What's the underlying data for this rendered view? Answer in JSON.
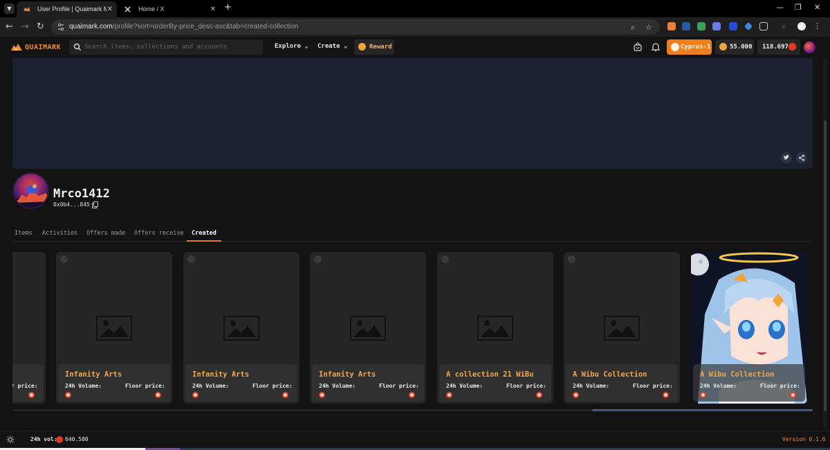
{
  "browser": {
    "tabs": [
      {
        "title": "User Profile | Quaimark Marketplace",
        "active": true
      },
      {
        "title": "Home / X",
        "active": false
      }
    ],
    "url_host": "quaimark.com",
    "url_path": "/profile?sort=orderBy-price_desc-asc&tab=created-collection"
  },
  "header": {
    "logo_text": "QUAIMARK",
    "search_placeholder": "Search items, collections and accounts",
    "explore_label": "Explore",
    "create_label": "Create",
    "reward_label": "Reward",
    "chain_label": "Cyprus-1",
    "points_value": "55.000",
    "balance_value": "118.697"
  },
  "profile": {
    "name": "Mrco1412",
    "address": "0x0b4...845"
  },
  "tabs": [
    "Items",
    "Activities",
    "Offers made",
    "Offers receive",
    "Created"
  ],
  "active_tab": "Created",
  "cards": [
    {
      "title": "",
      "vol_label": "",
      "floor_label": "r price:",
      "partial": true
    },
    {
      "title": "Infanity Arts",
      "vol_label": "24h Volume:",
      "floor_label": "Floor price:"
    },
    {
      "title": "Infanity Arts",
      "vol_label": "24h Volume:",
      "floor_label": "Floor price:"
    },
    {
      "title": "Infanity Arts",
      "vol_label": "24h Volume:",
      "floor_label": "Floor price:"
    },
    {
      "title": "A collection 21 WiBu",
      "vol_label": "24h Volume:",
      "floor_label": "Floor price:"
    },
    {
      "title": "A Wibu Collection",
      "vol_label": "24h Volume:",
      "floor_label": "Floor price:"
    },
    {
      "title": "A Wibu Collection",
      "vol_label": "24h Volume:",
      "floor_label": "Floor price:",
      "featured": true
    }
  ],
  "footer": {
    "vol_label": "24h vol:",
    "vol_value": "640.580",
    "version": "Version 0.1.6"
  },
  "colors": {
    "accent": "#ef7f1a",
    "title": "#f5a64a",
    "banner": "#1c2030",
    "quai_red": "#e83a20"
  }
}
